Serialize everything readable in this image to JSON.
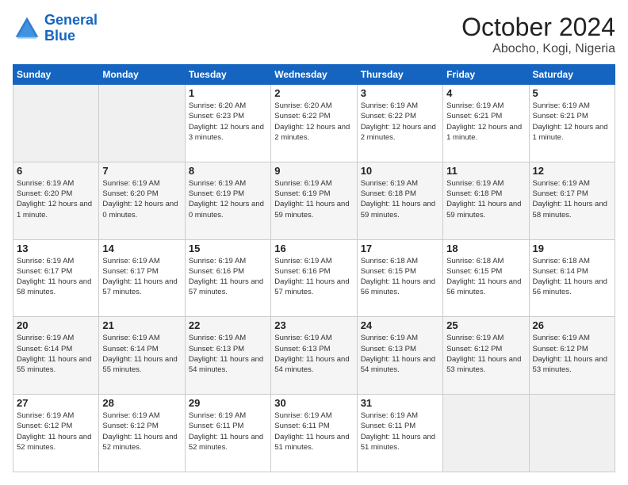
{
  "logo": {
    "line1": "General",
    "line2": "Blue"
  },
  "title": "October 2024",
  "location": "Abocho, Kogi, Nigeria",
  "days_of_week": [
    "Sunday",
    "Monday",
    "Tuesday",
    "Wednesday",
    "Thursday",
    "Friday",
    "Saturday"
  ],
  "weeks": [
    [
      {
        "num": "",
        "info": ""
      },
      {
        "num": "",
        "info": ""
      },
      {
        "num": "1",
        "info": "Sunrise: 6:20 AM\nSunset: 6:23 PM\nDaylight: 12 hours and 3 minutes."
      },
      {
        "num": "2",
        "info": "Sunrise: 6:20 AM\nSunset: 6:22 PM\nDaylight: 12 hours and 2 minutes."
      },
      {
        "num": "3",
        "info": "Sunrise: 6:19 AM\nSunset: 6:22 PM\nDaylight: 12 hours and 2 minutes."
      },
      {
        "num": "4",
        "info": "Sunrise: 6:19 AM\nSunset: 6:21 PM\nDaylight: 12 hours and 1 minute."
      },
      {
        "num": "5",
        "info": "Sunrise: 6:19 AM\nSunset: 6:21 PM\nDaylight: 12 hours and 1 minute."
      }
    ],
    [
      {
        "num": "6",
        "info": "Sunrise: 6:19 AM\nSunset: 6:20 PM\nDaylight: 12 hours and 1 minute."
      },
      {
        "num": "7",
        "info": "Sunrise: 6:19 AM\nSunset: 6:20 PM\nDaylight: 12 hours and 0 minutes."
      },
      {
        "num": "8",
        "info": "Sunrise: 6:19 AM\nSunset: 6:19 PM\nDaylight: 12 hours and 0 minutes."
      },
      {
        "num": "9",
        "info": "Sunrise: 6:19 AM\nSunset: 6:19 PM\nDaylight: 11 hours and 59 minutes."
      },
      {
        "num": "10",
        "info": "Sunrise: 6:19 AM\nSunset: 6:18 PM\nDaylight: 11 hours and 59 minutes."
      },
      {
        "num": "11",
        "info": "Sunrise: 6:19 AM\nSunset: 6:18 PM\nDaylight: 11 hours and 59 minutes."
      },
      {
        "num": "12",
        "info": "Sunrise: 6:19 AM\nSunset: 6:17 PM\nDaylight: 11 hours and 58 minutes."
      }
    ],
    [
      {
        "num": "13",
        "info": "Sunrise: 6:19 AM\nSunset: 6:17 PM\nDaylight: 11 hours and 58 minutes."
      },
      {
        "num": "14",
        "info": "Sunrise: 6:19 AM\nSunset: 6:17 PM\nDaylight: 11 hours and 57 minutes."
      },
      {
        "num": "15",
        "info": "Sunrise: 6:19 AM\nSunset: 6:16 PM\nDaylight: 11 hours and 57 minutes."
      },
      {
        "num": "16",
        "info": "Sunrise: 6:19 AM\nSunset: 6:16 PM\nDaylight: 11 hours and 57 minutes."
      },
      {
        "num": "17",
        "info": "Sunrise: 6:18 AM\nSunset: 6:15 PM\nDaylight: 11 hours and 56 minutes."
      },
      {
        "num": "18",
        "info": "Sunrise: 6:18 AM\nSunset: 6:15 PM\nDaylight: 11 hours and 56 minutes."
      },
      {
        "num": "19",
        "info": "Sunrise: 6:18 AM\nSunset: 6:14 PM\nDaylight: 11 hours and 56 minutes."
      }
    ],
    [
      {
        "num": "20",
        "info": "Sunrise: 6:19 AM\nSunset: 6:14 PM\nDaylight: 11 hours and 55 minutes."
      },
      {
        "num": "21",
        "info": "Sunrise: 6:19 AM\nSunset: 6:14 PM\nDaylight: 11 hours and 55 minutes."
      },
      {
        "num": "22",
        "info": "Sunrise: 6:19 AM\nSunset: 6:13 PM\nDaylight: 11 hours and 54 minutes."
      },
      {
        "num": "23",
        "info": "Sunrise: 6:19 AM\nSunset: 6:13 PM\nDaylight: 11 hours and 54 minutes."
      },
      {
        "num": "24",
        "info": "Sunrise: 6:19 AM\nSunset: 6:13 PM\nDaylight: 11 hours and 54 minutes."
      },
      {
        "num": "25",
        "info": "Sunrise: 6:19 AM\nSunset: 6:12 PM\nDaylight: 11 hours and 53 minutes."
      },
      {
        "num": "26",
        "info": "Sunrise: 6:19 AM\nSunset: 6:12 PM\nDaylight: 11 hours and 53 minutes."
      }
    ],
    [
      {
        "num": "27",
        "info": "Sunrise: 6:19 AM\nSunset: 6:12 PM\nDaylight: 11 hours and 52 minutes."
      },
      {
        "num": "28",
        "info": "Sunrise: 6:19 AM\nSunset: 6:12 PM\nDaylight: 11 hours and 52 minutes."
      },
      {
        "num": "29",
        "info": "Sunrise: 6:19 AM\nSunset: 6:11 PM\nDaylight: 11 hours and 52 minutes."
      },
      {
        "num": "30",
        "info": "Sunrise: 6:19 AM\nSunset: 6:11 PM\nDaylight: 11 hours and 51 minutes."
      },
      {
        "num": "31",
        "info": "Sunrise: 6:19 AM\nSunset: 6:11 PM\nDaylight: 11 hours and 51 minutes."
      },
      {
        "num": "",
        "info": ""
      },
      {
        "num": "",
        "info": ""
      }
    ]
  ]
}
